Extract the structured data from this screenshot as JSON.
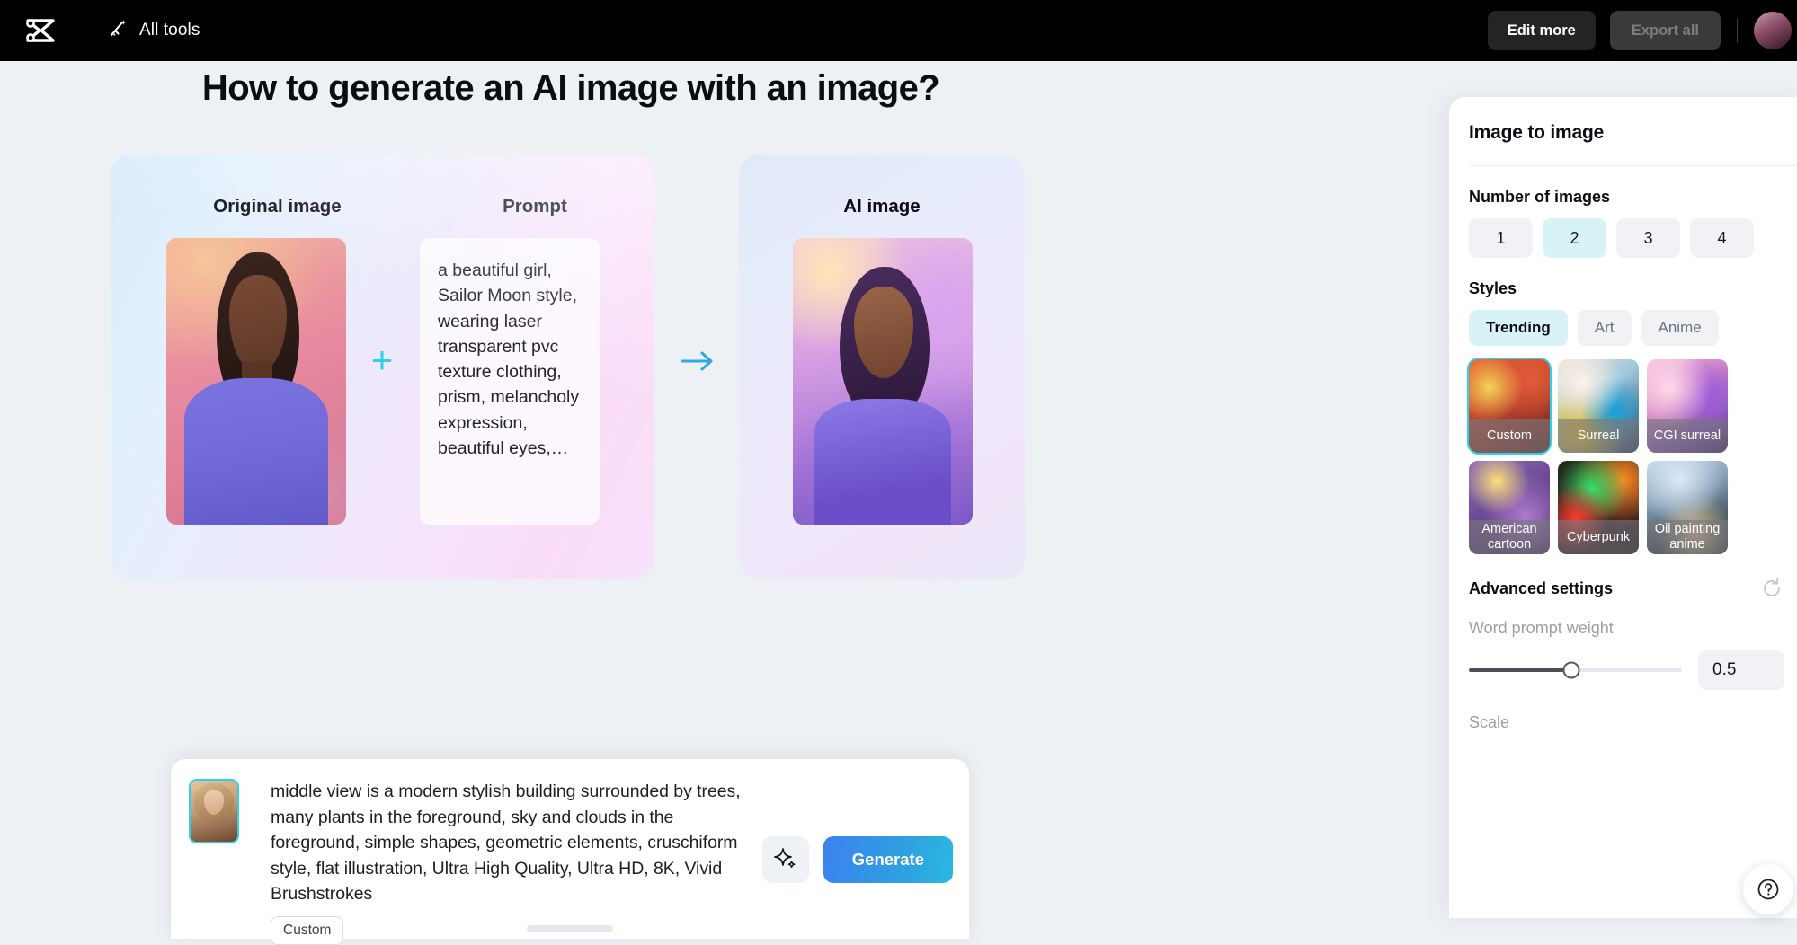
{
  "topbar": {
    "logo_icon": "capcut-logo-icon",
    "all_tools_icon": "magic-wand-icon",
    "all_tools_label": "All tools",
    "edit_more_label": "Edit more",
    "export_all_label": "Export all",
    "avatar_name": "user-avatar"
  },
  "page": {
    "title": "How to generate an AI image with an image?"
  },
  "demo": {
    "original_label": "Original image",
    "prompt_label": "Prompt",
    "ai_label": "AI image",
    "plus_symbol": "+",
    "arrow_icon": "arrow-right-icon",
    "prompt_text": "a beautiful girl, Sailor Moon style, wearing laser transparent pvc texture clothing, prism, melancholy expression, beautiful eyes,…"
  },
  "prompt_bar": {
    "thumbnail_name": "reference-image-thumbnail",
    "text": "middle view is a modern stylish building surrounded by trees, many plants in the foreground, sky and clouds in the foreground, simple shapes, geometric elements, cruschiform style, flat illustration, Ultra High Quality, Ultra HD, 8K, Vivid Brushstrokes",
    "tag_label": "Custom",
    "magic_icon": "sparkle-icon",
    "generate_label": "Generate",
    "generate_color": "#2f9fe0"
  },
  "panel": {
    "title": "Image to image",
    "number_of_images_label": "Number of images",
    "number_options": [
      "1",
      "2",
      "3",
      "4"
    ],
    "number_selected": "2",
    "styles_label": "Styles",
    "style_tabs": [
      "Trending",
      "Art",
      "Anime"
    ],
    "style_tab_selected": "Trending",
    "style_cards": [
      {
        "label": "Custom",
        "selected": true,
        "art": "art-custom"
      },
      {
        "label": "Surreal",
        "selected": false,
        "art": "art-surreal"
      },
      {
        "label": "CGI surreal",
        "selected": false,
        "art": "art-cgi"
      },
      {
        "label": "American cartoon",
        "selected": false,
        "art": "art-amcartoon"
      },
      {
        "label": "Cyberpunk",
        "selected": false,
        "art": "art-cyberpunk"
      },
      {
        "label": "Oil painting anime",
        "selected": false,
        "art": "art-oil"
      }
    ],
    "advanced_settings_label": "Advanced settings",
    "reset_icon": "reset-icon",
    "word_prompt_weight_label": "Word prompt weight",
    "word_prompt_weight_value": "0.5",
    "scale_label": "Scale",
    "selected_accent": "#2ed1e8",
    "active_chip_bg": "#d7f3f7"
  }
}
